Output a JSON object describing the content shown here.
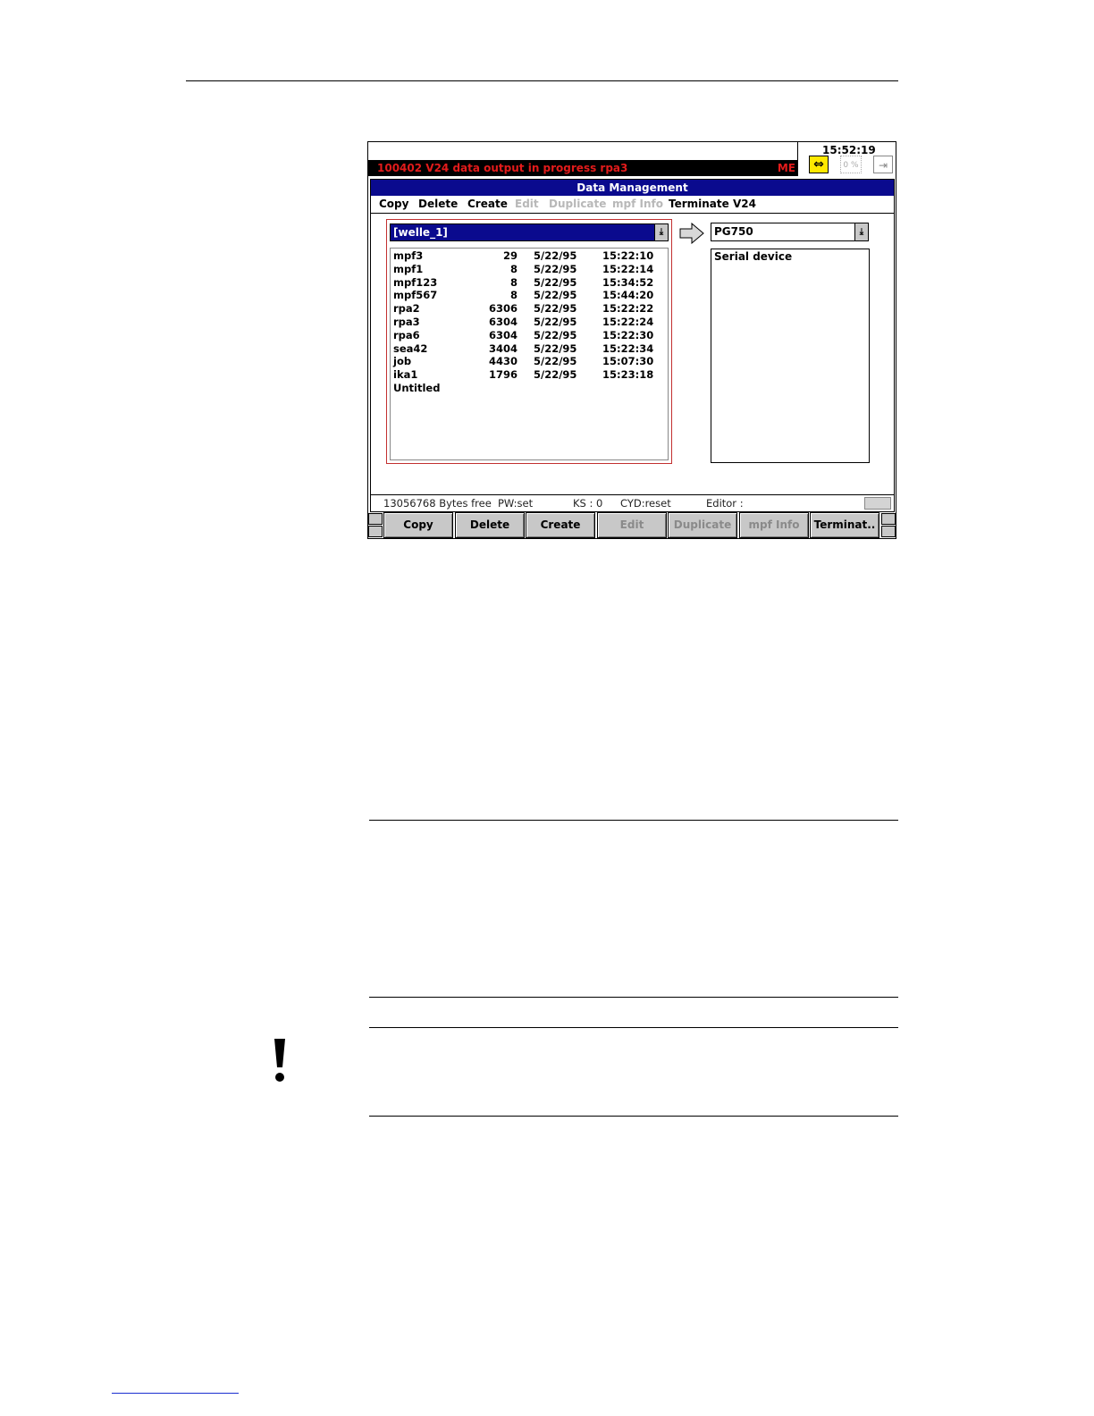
{
  "clock": "15:52:19",
  "alarm": {
    "text": "100402   V24 data output in progress rpa3",
    "channel": "ME"
  },
  "status_icons": {
    "grey_label": "0 %"
  },
  "window": {
    "title": "Data Management"
  },
  "menu": [
    {
      "label": "Copy",
      "enabled": true
    },
    {
      "label": "Delete",
      "enabled": true
    },
    {
      "label": "Create",
      "enabled": true
    },
    {
      "label": "Edit",
      "enabled": false
    },
    {
      "label": "Duplicate",
      "enabled": false
    },
    {
      "label": "mpf Info",
      "enabled": false
    },
    {
      "label": "Terminate V24",
      "enabled": true
    }
  ],
  "source": {
    "selected": "[welle_1]",
    "files": [
      {
        "name": "mpf3",
        "size": "29",
        "date": "5/22/95",
        "time": "15:22:10"
      },
      {
        "name": "mpf1",
        "size": "8",
        "date": "5/22/95",
        "time": "15:22:14"
      },
      {
        "name": "mpf123",
        "size": "8",
        "date": "5/22/95",
        "time": "15:34:52"
      },
      {
        "name": "mpf567",
        "size": "8",
        "date": "5/22/95",
        "time": "15:44:20"
      },
      {
        "name": "rpa2",
        "size": "6306",
        "date": "5/22/95",
        "time": "15:22:22"
      },
      {
        "name": "rpa3",
        "size": "6304",
        "date": "5/22/95",
        "time": "15:22:24"
      },
      {
        "name": "rpa6",
        "size": "6304",
        "date": "5/22/95",
        "time": "15:22:30"
      },
      {
        "name": "sea42",
        "size": "3404",
        "date": "5/22/95",
        "time": "15:22:34"
      },
      {
        "name": "job",
        "size": "4430",
        "date": "5/22/95",
        "time": "15:07:30"
      },
      {
        "name": "ika1",
        "size": "1796",
        "date": "5/22/95",
        "time": "15:23:18"
      },
      {
        "name": "Untitled",
        "size": "",
        "date": "",
        "time": ""
      }
    ]
  },
  "destination": {
    "selected": "PG750",
    "items": [
      "Serial device"
    ]
  },
  "statusline": {
    "bytes_free": "13056768 Bytes free",
    "pw": "PW:set",
    "ks": "KS : 0",
    "cyd": "CYD:reset",
    "editor": "Editor :"
  },
  "softkeys": [
    {
      "label": "Copy",
      "enabled": true
    },
    {
      "label": "Delete",
      "enabled": true
    },
    {
      "label": "Create",
      "enabled": true
    },
    {
      "label": "Edit",
      "enabled": false
    },
    {
      "label": "Duplicate",
      "enabled": false
    },
    {
      "label": "mpf Info",
      "enabled": false
    },
    {
      "label": "Terminat..",
      "enabled": true
    }
  ]
}
